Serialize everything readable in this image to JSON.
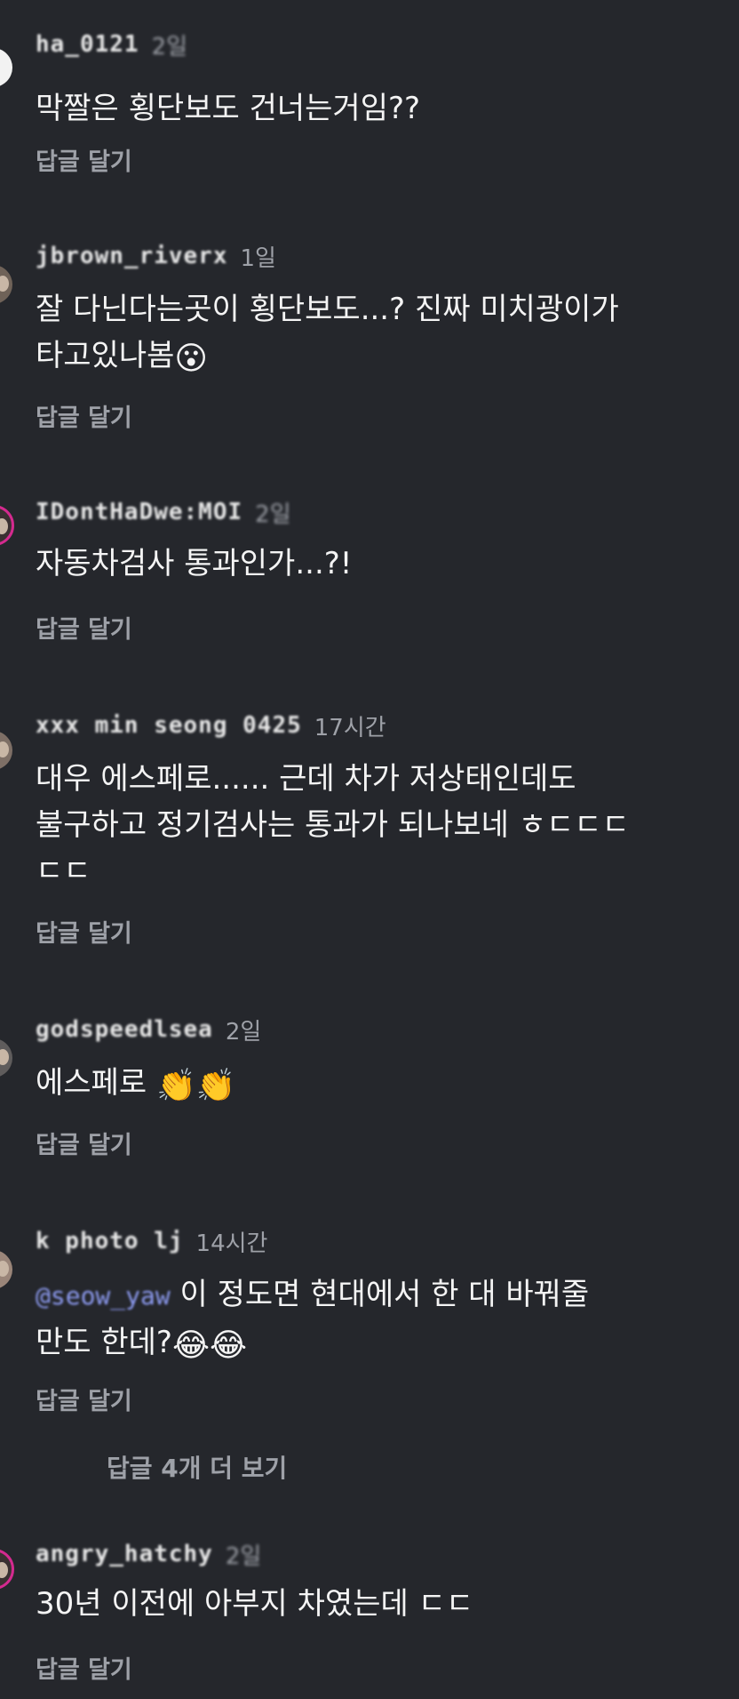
{
  "reply_label": "답글 달기",
  "more_replies": "답글 4개 더 보기",
  "comments": [
    {
      "username": "ha_0121",
      "time": "2일",
      "line1": "막짤은 횡단보도 건너는거임??"
    },
    {
      "username": "jbrown_riverx",
      "time": "1일",
      "line1": "잘 다닌다는곳이 횡단보도...? 진짜 미치광이가",
      "line2": "타고있나봄",
      "emoji": "😮"
    },
    {
      "username": "IDontHaDwe:MOI",
      "time": "2일",
      "line1": "자동차검사 통과인가...?!"
    },
    {
      "username": "xxx min seong 0425",
      "time": "17시간",
      "line1": "대우 에스페로...... 근데 차가 저상태인데도",
      "line2": "불구하고 정기검사는 통과가 되나보네 ㅎㄷㄷㄷ",
      "line3": "ㄷㄷ"
    },
    {
      "username": "godspeedlsea",
      "time": "2일",
      "line1": "에스페로 ",
      "emoji": "👏👏"
    },
    {
      "username": "k photo lj",
      "time": "14시간",
      "mention": "@seow_yaw",
      "line1": "이 정도면 현대에서 한 대 바꿔줄",
      "line2": "만도 한데?",
      "emoji": "😂😂"
    },
    {
      "username": "angry_hatchy",
      "time": "2일",
      "line1": "30년 이전에 아부지 차였는데 ㄷㄷ"
    }
  ]
}
